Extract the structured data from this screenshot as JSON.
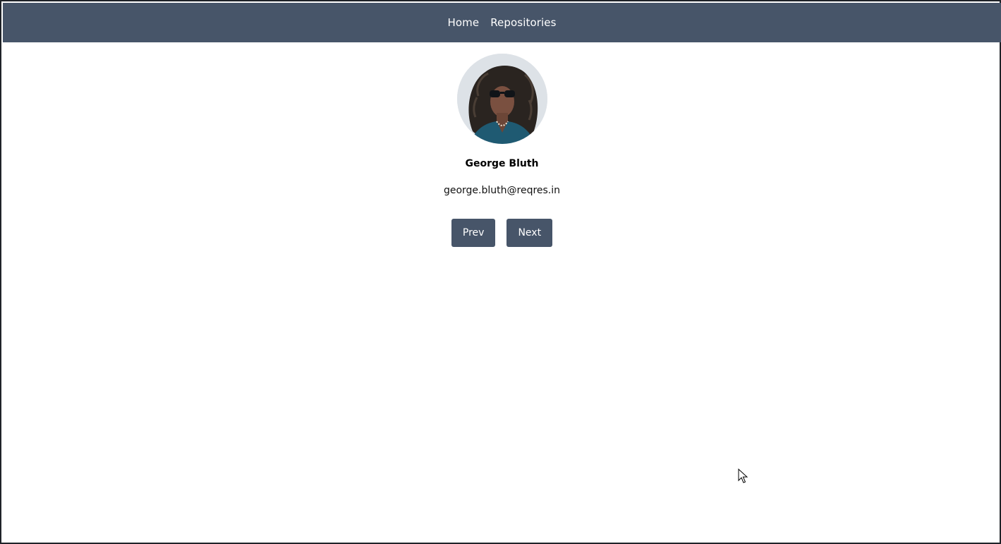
{
  "nav": {
    "links": [
      {
        "label": "Home"
      },
      {
        "label": "Repositories"
      }
    ]
  },
  "profile": {
    "avatar_icon": "user-avatar-photo",
    "name": "George Bluth",
    "email": "george.bluth@reqres.in"
  },
  "pagination": {
    "prev_label": "Prev",
    "next_label": "Next"
  },
  "colors": {
    "navbar": "#475569",
    "button": "#475569",
    "nav_text": "#ffffff"
  }
}
